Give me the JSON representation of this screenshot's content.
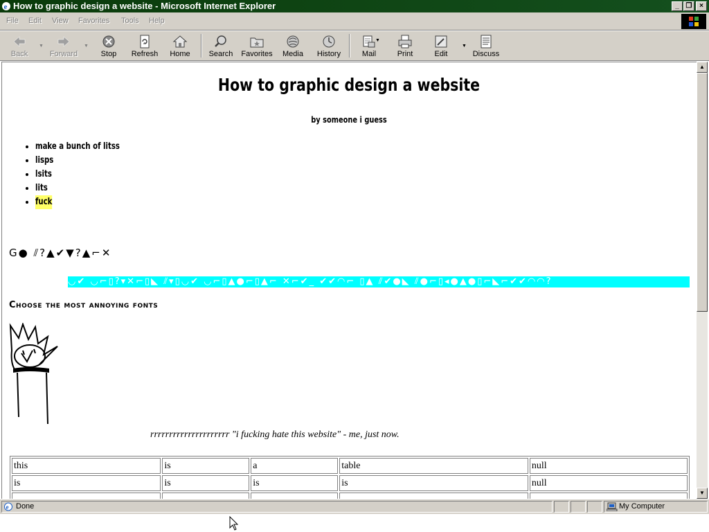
{
  "window": {
    "title": "How to graphic design a website - Microsoft Internet Explorer",
    "controls": [
      "_",
      "❐",
      "×"
    ]
  },
  "menu": {
    "items": [
      "File",
      "Edit",
      "View",
      "Favorites",
      "Tools",
      "Help"
    ]
  },
  "toolbar": {
    "buttons": [
      {
        "label": "Back",
        "icon": "back-arrow-icon",
        "enabled": false
      },
      {
        "label": "Forward",
        "icon": "forward-arrow-icon",
        "enabled": false
      },
      {
        "label": "Stop",
        "icon": "stop-icon",
        "enabled": true
      },
      {
        "label": "Refresh",
        "icon": "refresh-icon",
        "enabled": true
      },
      {
        "label": "Home",
        "icon": "home-icon",
        "enabled": true
      },
      {
        "label": "Search",
        "icon": "search-icon",
        "enabled": true
      },
      {
        "label": "Favorites",
        "icon": "favorites-icon",
        "enabled": true
      },
      {
        "label": "Media",
        "icon": "media-icon",
        "enabled": true
      },
      {
        "label": "History",
        "icon": "history-icon",
        "enabled": true
      },
      {
        "label": "Mail",
        "icon": "mail-icon",
        "enabled": true
      },
      {
        "label": "Print",
        "icon": "print-icon",
        "enabled": true
      },
      {
        "label": "Edit",
        "icon": "edit-icon",
        "enabled": true
      },
      {
        "label": "Discuss",
        "icon": "discuss-icon",
        "enabled": true
      }
    ]
  },
  "page": {
    "title": "How to graphic design a website",
    "byline": "by someone i guess",
    "list": [
      "make a bunch of litss",
      "lisps",
      "lsits",
      "lits",
      "fuck"
    ],
    "wingding_line": "G● ⫽?▲✔▼?▲⌐✕",
    "cyan_line": "◡✔ ◡⌐▯?▾✕⌐▯◣ ⫽▾▯◡✔ ◡⌐▯▲●⌐▯▲⌐ ✕⌐✔_ ✔✔◠⌐ ▯▲ ⫽✔●◣ ⫽●⌐▯◂●▲●▯⌐◣⌐✔✔◠◠?",
    "fonts_heading": "Choose the most annoying fonts",
    "quote": "rrrrrrrrrrrrrrrrrrrrr \"i fucking hate this website\" - me, just now.",
    "table": [
      [
        "this",
        "is",
        "a",
        "table",
        "null"
      ],
      [
        "is",
        "is",
        "is",
        "is",
        "null"
      ],
      [
        "",
        "",
        "",
        "",
        ""
      ]
    ]
  },
  "status": {
    "text": "Done",
    "zone": "My Computer"
  },
  "colors": {
    "titlebar": "#0a3a0a",
    "chrome": "#d4d0c8",
    "cyan_band": "#00ffff",
    "highlight": "#ffff66"
  }
}
